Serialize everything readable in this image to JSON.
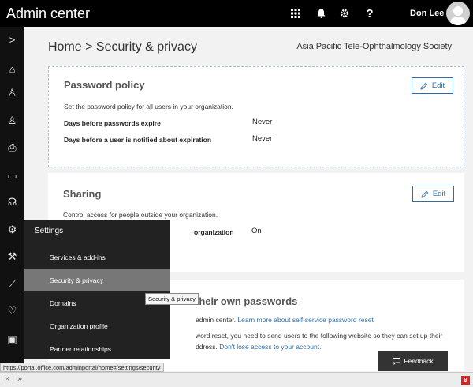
{
  "topbar": {
    "title": "Admin center",
    "waffle_icon": "waffle-icon",
    "bell_icon": "bell-icon",
    "gear_icon": "gear-icon",
    "help_label": "?",
    "user_name": "Don Lee"
  },
  "rail": {
    "items": [
      {
        "icon": "chevron-right-icon",
        "glyph": ">"
      },
      {
        "icon": "home-icon",
        "glyph": "⌂"
      },
      {
        "icon": "user-icon",
        "glyph": "♙"
      },
      {
        "icon": "users-icon",
        "glyph": "♙"
      },
      {
        "icon": "print-icon",
        "glyph": "⎙"
      },
      {
        "icon": "billing-icon",
        "glyph": "▭"
      },
      {
        "icon": "headset-icon",
        "glyph": "☊"
      },
      {
        "icon": "settings-icon",
        "glyph": "⚙"
      },
      {
        "icon": "wrench-icon",
        "glyph": "⚒"
      },
      {
        "icon": "chart-icon",
        "glyph": "⟋"
      },
      {
        "icon": "health-icon",
        "glyph": "♡"
      },
      {
        "icon": "exchange-icon",
        "glyph": "▣"
      }
    ]
  },
  "breadcrumb": "Home > Security & privacy",
  "organization": "Asia Pacific Tele-Ophthalmology Society",
  "password_policy": {
    "title": "Password policy",
    "edit_label": "Edit",
    "description": "Set the password policy for all users in your organization.",
    "rows": [
      {
        "key": "Days before passwords expire",
        "value": "Never"
      },
      {
        "key": "Days before a user is notified about expiration",
        "value": "Never"
      }
    ]
  },
  "sharing": {
    "title": "Sharing",
    "edit_label": "Edit",
    "description": "Control access for people outside your organization.",
    "row_key_visible": "organization",
    "row_value": "On"
  },
  "self_service": {
    "title_visible": "their own passwords",
    "line1_visible": "admin center.",
    "line1_link": "Learn more about self-service password reset",
    "line2": "word reset, you need to send users to the following website so they can set up their",
    "line3_visible": "ddress.",
    "line3_link": "Don't lose access to your account."
  },
  "settings_flyout": {
    "header": "Settings",
    "items": [
      {
        "label": "Services & add-ins",
        "selected": false
      },
      {
        "label": "Security & privacy",
        "selected": true
      },
      {
        "label": "Domains",
        "selected": false
      },
      {
        "label": "Organization profile",
        "selected": false
      },
      {
        "label": "Partner relationships",
        "selected": false
      }
    ]
  },
  "tooltip": "Security & privacy",
  "status_url": "https://portal.office.com/adminportal/home#/settings/security",
  "feedback_label": "Feedback",
  "bottombar": {
    "close_glyph": "×",
    "expand_glyph": "»",
    "badge": "8"
  }
}
